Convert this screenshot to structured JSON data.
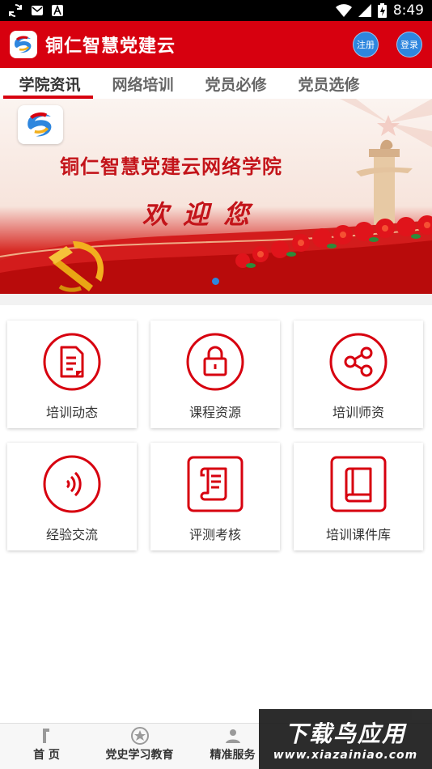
{
  "status_bar": {
    "time": "8:49",
    "icons": [
      "sync-icon",
      "mail-icon",
      "a-icon",
      "wifi-icon",
      "signal-icon",
      "battery-icon"
    ]
  },
  "app": {
    "title": "铜仁智慧党建云",
    "register_label": "注册",
    "login_label": "登录",
    "brand_color": "#d7000f"
  },
  "tabs": [
    {
      "label": "学院资讯",
      "active": true
    },
    {
      "label": "网络培训",
      "active": false
    },
    {
      "label": "党员必修",
      "active": false
    },
    {
      "label": "党员选修",
      "active": false
    }
  ],
  "banner": {
    "title": "铜仁智慧党建云网络学院",
    "welcome": "欢迎您",
    "slide_index": 1,
    "slide_count": 1
  },
  "grid": [
    {
      "label": "培训动态",
      "icon": "document-icon"
    },
    {
      "label": "课程资源",
      "icon": "lock-icon"
    },
    {
      "label": "培训师资",
      "icon": "share-icon"
    },
    {
      "label": "经验交流",
      "icon": "sound-wave-icon"
    },
    {
      "label": "评测考核",
      "icon": "scroll-icon"
    },
    {
      "label": "培训课件库",
      "icon": "book-icon"
    }
  ],
  "bottom_nav": [
    {
      "label": "首 页",
      "icon": "home-icon"
    },
    {
      "label": "党史学习教育",
      "icon": "star-icon"
    },
    {
      "label": "精准服务",
      "icon": "service-icon"
    }
  ],
  "watermark": {
    "title": "下载鸟应用",
    "url": "www.xiazainiao.com"
  }
}
